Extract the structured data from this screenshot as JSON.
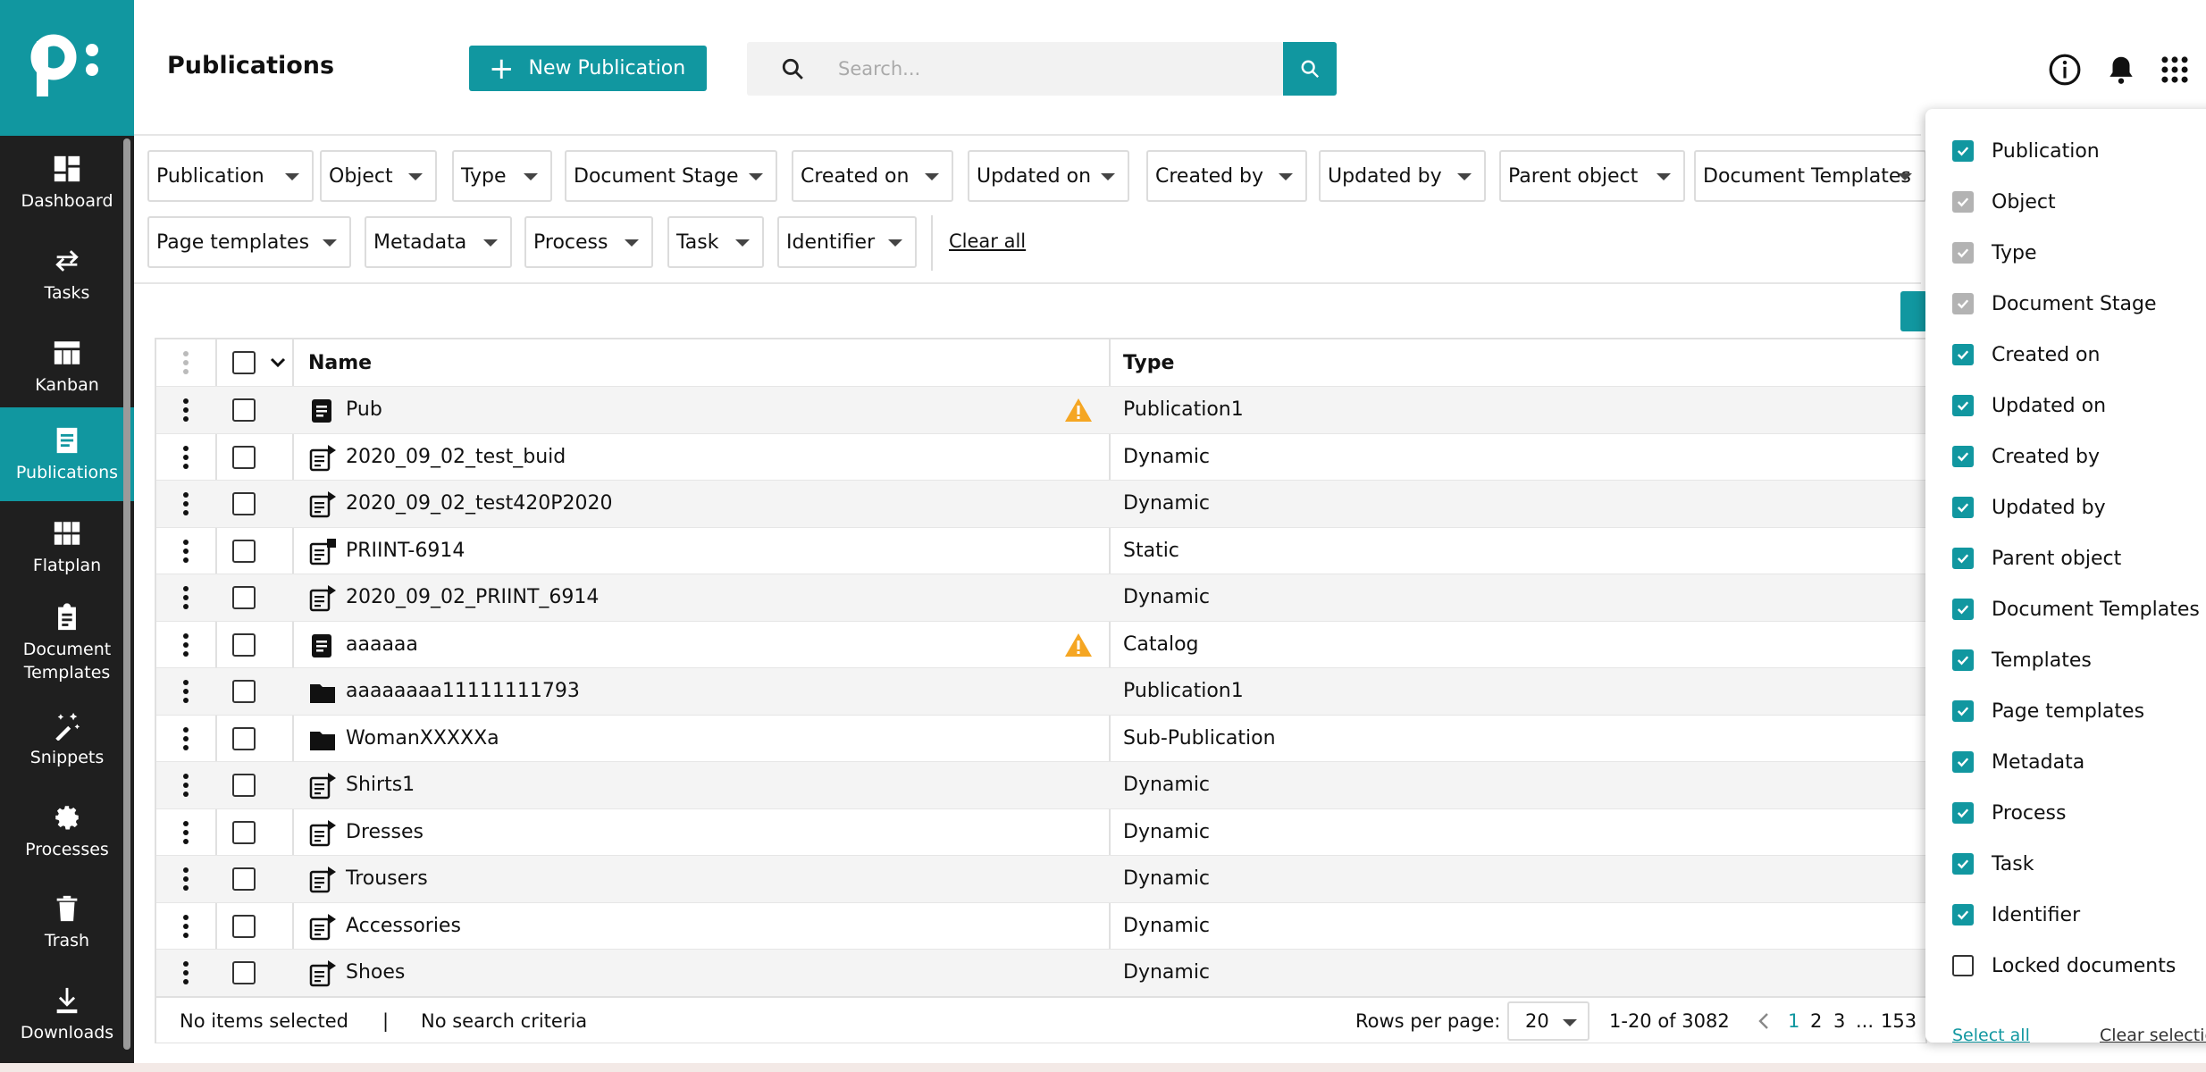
{
  "colors": {
    "brand": "#1197a0",
    "sidebar": "#1f1f1f",
    "warning": "#f5a623"
  },
  "sidebar": {
    "logo": "p:",
    "items": [
      {
        "label": "Dashboard",
        "icon": "dashboard-icon"
      },
      {
        "label": "Tasks",
        "icon": "repeat-icon"
      },
      {
        "label": "Kanban",
        "icon": "kanban-icon"
      },
      {
        "label": "Publications",
        "icon": "document-icon",
        "active": true
      },
      {
        "label": "Flatplan",
        "icon": "grid-icon"
      },
      {
        "label": "Document Templates",
        "icon": "clipboard-icon"
      },
      {
        "label": "Snippets",
        "icon": "magic-wand-icon"
      },
      {
        "label": "Processes",
        "icon": "gear-icon"
      },
      {
        "label": "Trash",
        "icon": "trash-icon"
      },
      {
        "label": "Downloads",
        "icon": "download-icon"
      }
    ]
  },
  "header": {
    "title": "Publications",
    "new_button": "New Publication",
    "search_placeholder": "Search..."
  },
  "filters": {
    "chips": [
      "Publication",
      "Object",
      "Type",
      "Document Stage",
      "Created on",
      "Updated on",
      "Created by",
      "Updated by",
      "Parent object",
      "Document Templates",
      "Page templates",
      "Metadata",
      "Process",
      "Task",
      "Identifier"
    ],
    "clear_all": "Clear all"
  },
  "table": {
    "columns": {
      "name": "Name",
      "type": "Type"
    },
    "rows": [
      {
        "name": "Pub",
        "type": "Publication1",
        "icon": "document-icon",
        "warning": true
      },
      {
        "name": "2020_09_02_test_buid",
        "type": "Dynamic",
        "icon": "dynamic-document-icon",
        "warning": false
      },
      {
        "name": "2020_09_02_test420P2020",
        "type": "Dynamic",
        "icon": "dynamic-document-icon",
        "warning": false
      },
      {
        "name": "PRIINT-6914",
        "type": "Static",
        "icon": "static-document-icon",
        "warning": false
      },
      {
        "name": "2020_09_02_PRIINT_6914",
        "type": "Dynamic",
        "icon": "dynamic-document-icon",
        "warning": false
      },
      {
        "name": "aaaaaa",
        "type": "Catalog",
        "icon": "document-icon",
        "warning": true
      },
      {
        "name": "aaaaaaaa11111111793",
        "type": "Publication1",
        "icon": "folder-icon",
        "warning": false
      },
      {
        "name": "WomanXXXXXa",
        "type": "Sub-Publication",
        "icon": "folder-icon",
        "warning": false
      },
      {
        "name": "Shirts1",
        "type": "Dynamic",
        "icon": "dynamic-document-icon",
        "warning": false
      },
      {
        "name": "Dresses",
        "type": "Dynamic",
        "icon": "dynamic-document-icon",
        "warning": false
      },
      {
        "name": "Trousers",
        "type": "Dynamic",
        "icon": "dynamic-document-icon",
        "warning": false
      },
      {
        "name": "Accessories",
        "type": "Dynamic",
        "icon": "dynamic-document-icon",
        "warning": false
      },
      {
        "name": "Shoes",
        "type": "Dynamic",
        "icon": "dynamic-document-icon",
        "warning": false
      }
    ],
    "footer": {
      "selection": "No items selected",
      "separator": "|",
      "criteria": "No search criteria",
      "rows_per_page_label": "Rows per page:",
      "rows_per_page": "20",
      "range": "1-20 of 3082",
      "pages": [
        "1",
        "2",
        "3",
        "...",
        "153"
      ],
      "current_page": "1"
    }
  },
  "column_panel": {
    "options": [
      {
        "label": "Publication",
        "state": "checked"
      },
      {
        "label": "Object",
        "state": "disabled"
      },
      {
        "label": "Type",
        "state": "disabled"
      },
      {
        "label": "Document Stage",
        "state": "disabled"
      },
      {
        "label": "Created on",
        "state": "checked"
      },
      {
        "label": "Updated on",
        "state": "checked"
      },
      {
        "label": "Created by",
        "state": "checked"
      },
      {
        "label": "Updated by",
        "state": "checked"
      },
      {
        "label": "Parent object",
        "state": "checked"
      },
      {
        "label": "Document Templates",
        "state": "checked"
      },
      {
        "label": "Templates",
        "state": "checked"
      },
      {
        "label": "Page templates",
        "state": "checked"
      },
      {
        "label": "Metadata",
        "state": "checked"
      },
      {
        "label": "Process",
        "state": "checked"
      },
      {
        "label": "Task",
        "state": "checked"
      },
      {
        "label": "Identifier",
        "state": "checked"
      },
      {
        "label": "Locked documents",
        "state": "unchecked"
      }
    ],
    "select_all": "Select all",
    "clear_selection": "Clear selection"
  }
}
